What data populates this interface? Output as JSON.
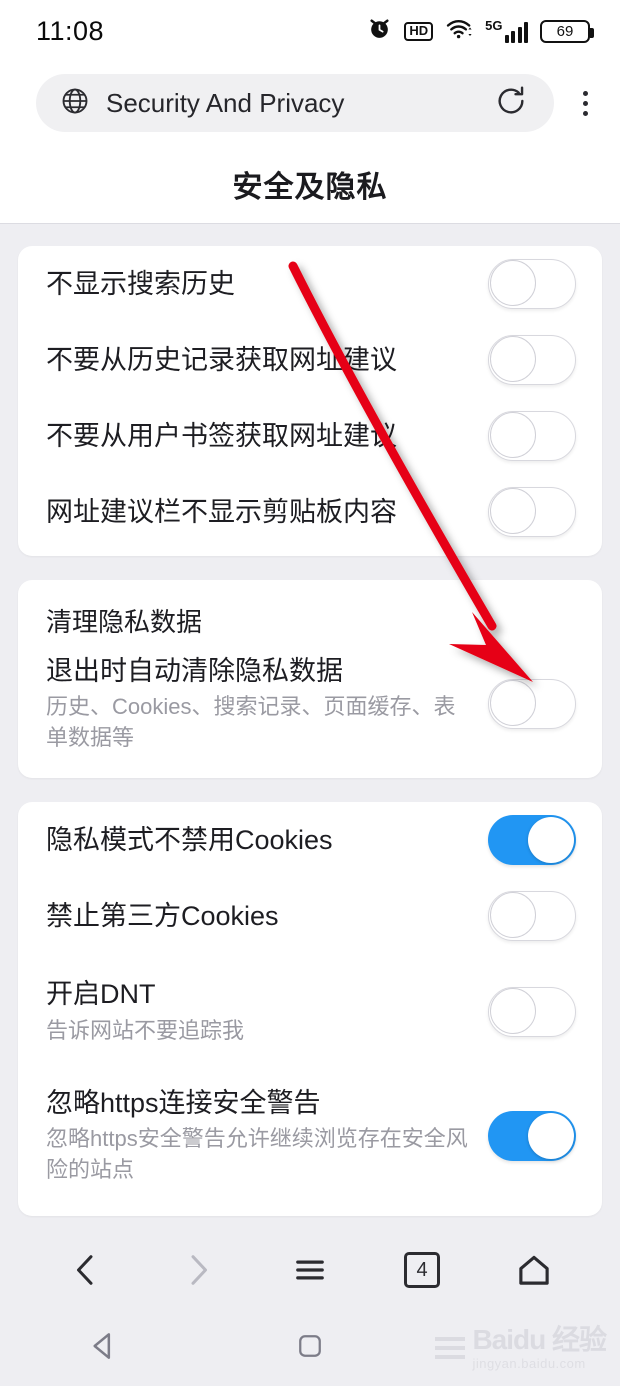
{
  "statusbar": {
    "time": "11:08",
    "battery_level": "69",
    "network_label": "5G",
    "hd_label": "HD",
    "icons": [
      "alarm-icon",
      "hd-icon",
      "wifi-icon",
      "signal-icon",
      "battery-icon"
    ]
  },
  "browser": {
    "url_title": "Security And Privacy",
    "globe_icon": "globe-icon",
    "reload_icon": "reload-icon",
    "overflow_icon": "more-vertical-icon"
  },
  "page": {
    "title": "安全及隐私"
  },
  "colors": {
    "toggle_on": "#2196f3",
    "toggle_off_track": "#ffffff",
    "page_background": "#eeeef2",
    "card_background": "#ffffff",
    "arrow": "#e60012"
  },
  "cards": [
    {
      "name": "search-suggestion-card",
      "rows": [
        {
          "title": "不显示搜索历史",
          "sub": "",
          "toggle": "off"
        },
        {
          "title": "不要从历史记录获取网址建议",
          "sub": "",
          "toggle": "off"
        },
        {
          "title": "不要从用户书签获取网址建议",
          "sub": "",
          "toggle": "off"
        },
        {
          "title": "网址建议栏不显示剪贴板内容",
          "sub": "",
          "toggle": "off"
        }
      ]
    },
    {
      "name": "clear-privacy-data-card",
      "group_title": "清理隐私数据",
      "rows": [
        {
          "title": "退出时自动清除隐私数据",
          "sub": "历史、Cookies、搜索记录、页面缓存、表单数据等",
          "toggle": "off"
        }
      ]
    },
    {
      "name": "cookies-and-security-card",
      "rows": [
        {
          "title": "隐私模式不禁用Cookies",
          "sub": "",
          "toggle": "on"
        },
        {
          "title": "禁止第三方Cookies",
          "sub": "",
          "toggle": "off"
        },
        {
          "title": "开启DNT",
          "sub": "告诉网站不要追踪我",
          "toggle": "off"
        },
        {
          "title": "忽略https连接安全警告",
          "sub": "忽略https安全警告允许继续浏览存在安全风险的站点",
          "toggle": "on"
        }
      ]
    }
  ],
  "browser_nav": {
    "back_label": "back-arrow",
    "forward_label": "forward-arrow",
    "menu_label": "menu-lines",
    "tab_count": "4",
    "home_label": "home-shape"
  },
  "system_nav": {
    "back": "triangle-back",
    "home": "square-home"
  },
  "watermark": {
    "main": "Baidu 经验",
    "sub": "jingyan.baidu.com"
  }
}
